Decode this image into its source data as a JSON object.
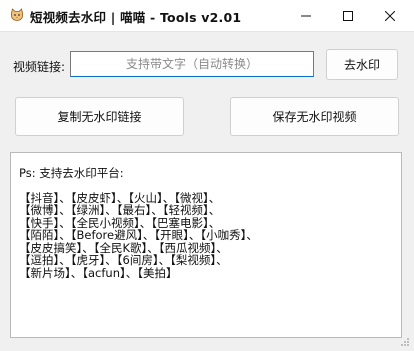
{
  "window": {
    "title": "短视频去水印 | 喵喵 - Tools v2.01",
    "icons": [
      "cat-icon",
      "minimize-icon",
      "maximize-icon",
      "close-icon"
    ]
  },
  "form": {
    "link_label": "视频链接:",
    "link_value": "",
    "link_placeholder": "支持带文字（自动转换）",
    "remove_button": "去水印",
    "copy_button": "复制无水印链接",
    "save_button": "保存无水印视频"
  },
  "output": {
    "heading": "Ps: 支持去水印平台:",
    "lines": [
      "【抖音】、【皮皮虾】、【火山】、【微视】、",
      "【微博】、【绿洲】、【最右】、【轻视频】、",
      "【快手】、【全民小视频】、【巴塞电影】、",
      "【陌陌】、【Before避风】、【开眼】、【小咖秀】、",
      "【皮皮搞笑】、【全民K歌】、【西瓜视频】、",
      "【逗拍】、【虎牙】、【6间房】、【梨视频】、",
      "【新片场】、【acfun】、【美拍】"
    ]
  },
  "colors": {
    "accent": "#0a6cc8",
    "background": "#f0f0f0"
  }
}
